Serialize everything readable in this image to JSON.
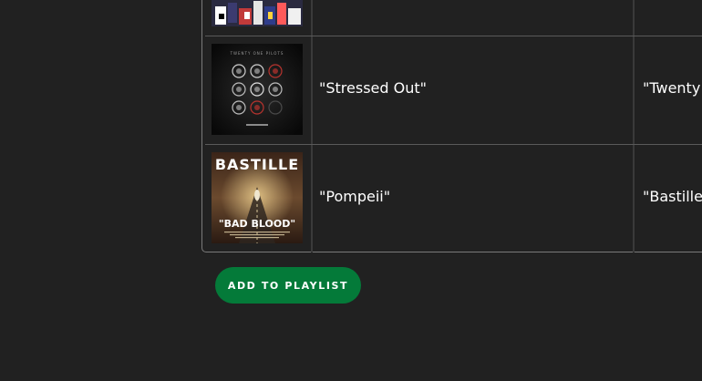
{
  "tracks": [
    {
      "song": "",
      "artist": "",
      "art_icon": "collage-album-art"
    },
    {
      "song": "\"Stressed Out\"",
      "artist": "\"Twenty",
      "art_icon": "blurryface-album-art",
      "art_text_top": "TWENTY ONE PILOTS"
    },
    {
      "song": "\"Pompeii\"",
      "artist": "\"Bastille\"",
      "art_icon": "bad-blood-album-art",
      "art_text_top": "BASTILLE",
      "art_text_bottom": "\"BAD BLOOD\""
    }
  ],
  "actions": {
    "add_to_playlist_label": "ADD TO PLAYLIST"
  },
  "colors": {
    "background": "#212121",
    "button": "#047a39",
    "text": "#ffffff"
  }
}
